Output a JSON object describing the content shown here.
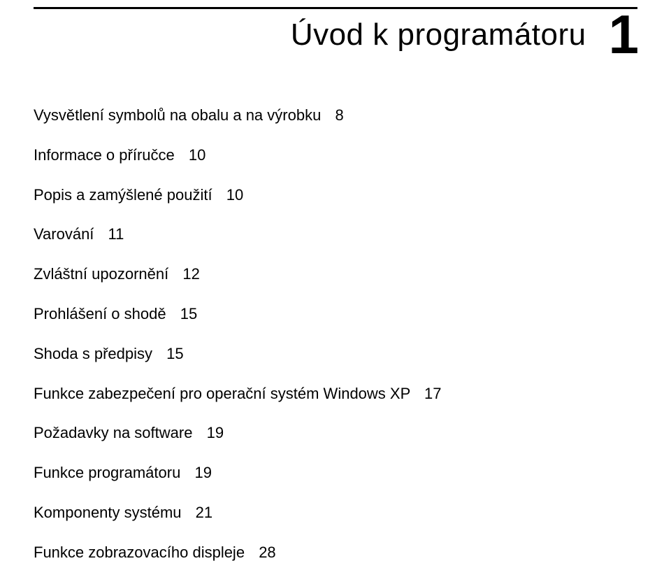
{
  "chapter": {
    "title": "Úvod k programátoru",
    "number": "1"
  },
  "toc": [
    {
      "label": "Vysvětlení symbolů na obalu a na výrobku",
      "page": "8"
    },
    {
      "label": "Informace o příručce",
      "page": "10"
    },
    {
      "label": "Popis a zamýšlené použití",
      "page": "10"
    },
    {
      "label": "Varování",
      "page": "11"
    },
    {
      "label": "Zvláštní upozornění",
      "page": "12"
    },
    {
      "label": "Prohlášení o shodě",
      "page": "15"
    },
    {
      "label": "Shoda s předpisy",
      "page": "15"
    },
    {
      "label": "Funkce zabezpečení pro operační systém Windows XP",
      "page": "17"
    },
    {
      "label": "Požadavky na software",
      "page": "19"
    },
    {
      "label": "Funkce programátoru",
      "page": "19"
    },
    {
      "label": "Komponenty systému",
      "page": "21"
    },
    {
      "label": "Funkce zobrazovacího displeje",
      "page": "28"
    }
  ]
}
